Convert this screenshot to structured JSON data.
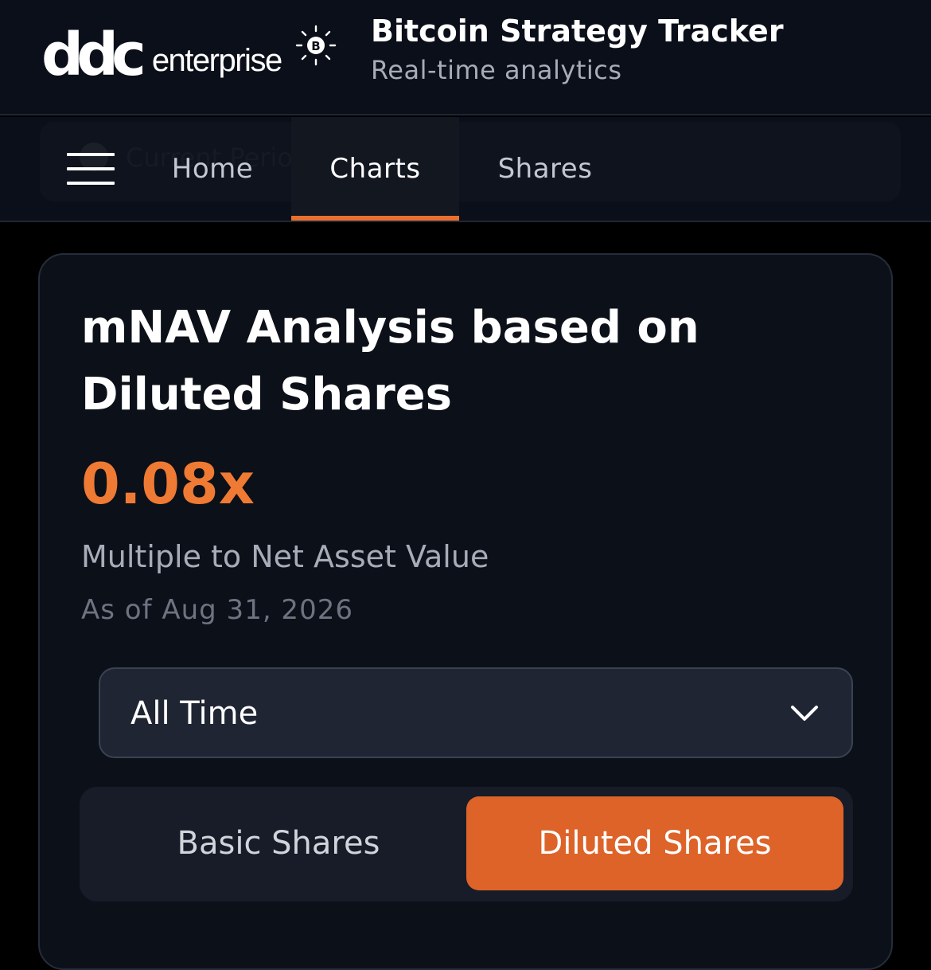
{
  "header": {
    "logo": {
      "brand": "ddc",
      "suffix": "enterprise",
      "icon": "bitcoin-sparkle-icon"
    },
    "title": "Bitcoin Strategy Tracker",
    "subtitle": "Real-time analytics"
  },
  "nav": {
    "menu_icon": "hamburger-menu-icon",
    "background_ghost_text": "Current Period (YTD/YTD)",
    "tabs": [
      {
        "label": "Home",
        "active": false
      },
      {
        "label": "Charts",
        "active": true
      },
      {
        "label": "Shares",
        "active": false
      }
    ]
  },
  "card": {
    "title": "mNAV Analysis based on Diluted Shares",
    "metric_value": "0.08x",
    "metric_label": "Multiple to Net Asset Value",
    "as_of": "As of Aug 31, 2026",
    "range_select": {
      "value": "All Time",
      "icon": "chevron-down-icon"
    },
    "share_toggle": {
      "options": [
        "Basic Shares",
        "Diluted Shares"
      ],
      "selected": "Diluted Shares"
    }
  },
  "colors": {
    "accent": "#e9702e",
    "metric": "#ef7a33",
    "toggle_active": "#dd6329",
    "background": "#000000",
    "surface": "#0b0f19"
  }
}
